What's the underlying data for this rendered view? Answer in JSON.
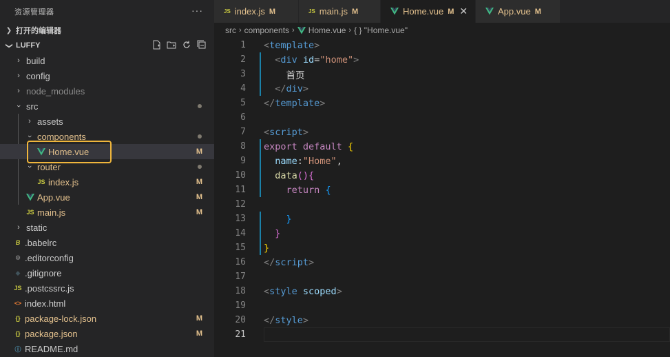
{
  "sidebar": {
    "title": "资源管理器",
    "more": "···",
    "open_editors": "打开的编辑器",
    "project": "LUFFY",
    "items": [
      {
        "name": "build",
        "kind": "folder",
        "state": "closed",
        "depth": 1
      },
      {
        "name": "config",
        "kind": "folder",
        "state": "closed",
        "depth": 1
      },
      {
        "name": "node_modules",
        "kind": "folder",
        "state": "closed",
        "depth": 1
      },
      {
        "name": "src",
        "kind": "folder",
        "state": "open",
        "depth": 1
      },
      {
        "name": "assets",
        "kind": "folder",
        "state": "closed",
        "depth": 2
      },
      {
        "name": "components",
        "kind": "folder",
        "state": "open",
        "depth": 2
      },
      {
        "name": "Home.vue",
        "kind": "vue",
        "depth": 3,
        "badge": "M"
      },
      {
        "name": "router",
        "kind": "folder",
        "state": "open",
        "depth": 2
      },
      {
        "name": "index.js",
        "kind": "js",
        "depth": 3,
        "badge": "M"
      },
      {
        "name": "App.vue",
        "kind": "vue",
        "depth": 2,
        "badge": "M"
      },
      {
        "name": "main.js",
        "kind": "js",
        "depth": 2,
        "badge": "M"
      },
      {
        "name": "static",
        "kind": "folder",
        "state": "closed",
        "depth": 1
      },
      {
        "name": ".babelrc",
        "kind": "babel",
        "depth": 1
      },
      {
        "name": ".editorconfig",
        "kind": "gear",
        "depth": 1
      },
      {
        "name": ".gitignore",
        "kind": "git",
        "depth": 1
      },
      {
        "name": ".postcssrc.js",
        "kind": "js",
        "depth": 1
      },
      {
        "name": "index.html",
        "kind": "html",
        "depth": 1
      },
      {
        "name": "package-lock.json",
        "kind": "json",
        "depth": 1,
        "badge": "M"
      },
      {
        "name": "package.json",
        "kind": "json",
        "depth": 1,
        "badge": "M"
      },
      {
        "name": "README.md",
        "kind": "info",
        "depth": 1
      }
    ]
  },
  "tabs": [
    {
      "label": "index.js",
      "icon": "JS",
      "mod": "M"
    },
    {
      "label": "main.js",
      "icon": "JS",
      "mod": "M"
    },
    {
      "label": "Home.vue",
      "icon": "vue",
      "mod": "M",
      "close": "✕"
    },
    {
      "label": "App.vue",
      "icon": "vue",
      "mod": "M"
    }
  ],
  "breadcrumb": {
    "p1": "src",
    "p2": "components",
    "p3": "Home.vue",
    "p4": "{ } \"Home.vue\""
  },
  "code": {
    "ln": [
      "1",
      "2",
      "3",
      "4",
      "5",
      "6",
      "7",
      "8",
      "9",
      "10",
      "11",
      "12",
      "13",
      "14",
      "15",
      "16",
      "17",
      "18",
      "19",
      "20",
      "21"
    ],
    "l1_open": "<",
    "l1_tag": "template",
    "l1_close": ">",
    "l2_open": "<",
    "l2_tag": "div",
    "l2_attr": "id",
    "l2_eq": "=",
    "l2_val": "\"home\"",
    "l2_close": ">",
    "l3_text": "首页",
    "l4_open": "</",
    "l4_tag": "div",
    "l4_close": ">",
    "l5_open": "</",
    "l5_tag": "template",
    "l5_close": ">",
    "l7_open": "<",
    "l7_tag": "script",
    "l7_close": ">",
    "l8_kw": "export default",
    "l8_br": "{",
    "l9_prop": "name",
    "l9_colon": ":",
    "l9_str": "\"Home\"",
    "l9_comma": ",",
    "l10_fn": "data",
    "l10_paren": "()",
    "l10_br": "{",
    "l11_kw": "return",
    "l11_br": "{",
    "l13_br": "}",
    "l14_br": "}",
    "l15_br": "}",
    "l16_open": "</",
    "l16_tag": "script",
    "l16_close": ">",
    "l18_open": "<",
    "l18_tag": "style",
    "l18_attr": "scoped",
    "l18_close": ">",
    "l20_open": "</",
    "l20_tag": "style",
    "l20_close": ">"
  }
}
